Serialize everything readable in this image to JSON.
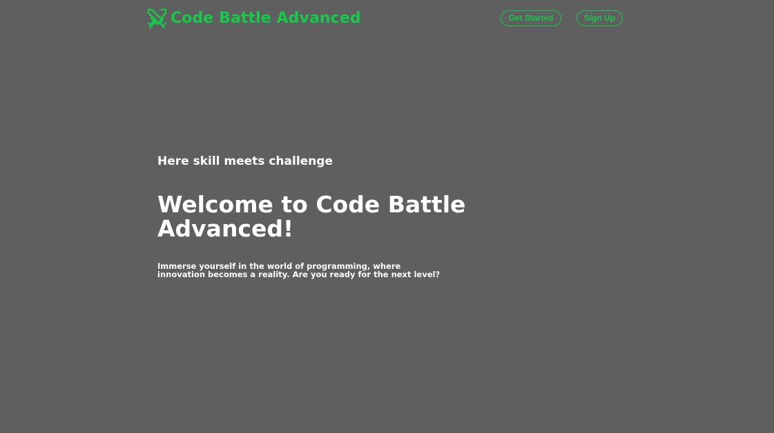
{
  "header": {
    "brand_name": "Code Battle Advanced",
    "brand_icon": "crossed-swords-icon",
    "get_started_label": "Get Started",
    "sign_up_label": "Sign Up"
  },
  "hero": {
    "tagline": "Here skill meets challenge",
    "title": "Welcome to Code Battle Advanced!",
    "subtitle": "Immerse yourself in the world of programming, where innovation becomes a reality. Are you ready for the next level?"
  },
  "colors": {
    "background": "#5f5f5f",
    "accent": "#16c94a",
    "text": "#ffffff"
  }
}
